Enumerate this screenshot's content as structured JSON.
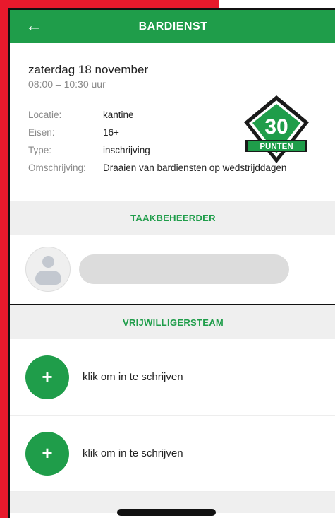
{
  "header": {
    "title": "BARDIENST",
    "back_icon": "arrow-left-icon"
  },
  "task": {
    "date": "zaterdag 18 november",
    "time": "08:00 – 10:30 uur",
    "fields": [
      {
        "label": "Locatie:",
        "value": "kantine"
      },
      {
        "label": "Eisen:",
        "value": "16+"
      },
      {
        "label": "Type:",
        "value": "inschrijving"
      },
      {
        "label": "Omschrijving:",
        "value": "Draaien van bardiensten op wedstrijddagen"
      }
    ],
    "points": {
      "value": "30",
      "label": "PUNTEN"
    }
  },
  "sections": {
    "manager_title": "TAAKBEHEERDER",
    "team_title": "VRIJWILLIGERSTEAM"
  },
  "volunteers": [
    {
      "label": "klik om in te schrijven",
      "icon": "plus-icon"
    },
    {
      "label": "klik om in te schrijven",
      "icon": "plus-icon"
    }
  ],
  "colors": {
    "accent": "#1f9d4a",
    "background": "#e8192c"
  }
}
